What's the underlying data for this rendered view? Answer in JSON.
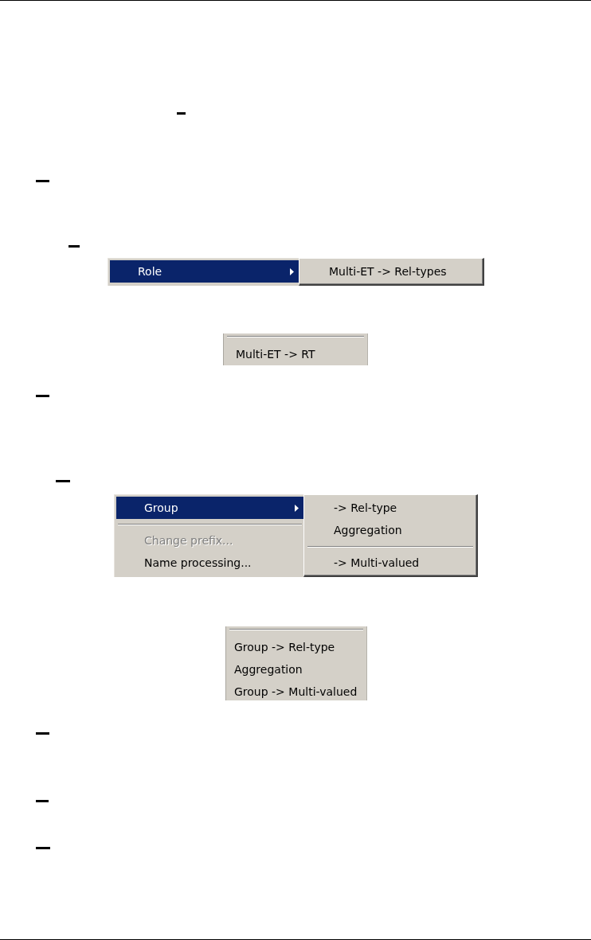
{
  "document": {
    "blocks": [
      {
        "kind": "dash"
      },
      {
        "kind": "dash"
      },
      {
        "kind": "dash"
      },
      {
        "kind": "cascade_menu",
        "items": [
          {
            "kind": "item",
            "label": "Role",
            "selected": true,
            "disabled": false,
            "submenu": [
              {
                "kind": "item",
                "label": "Multi-ET -> Rel-types",
                "selected": false,
                "disabled": false
              }
            ]
          }
        ]
      },
      {
        "kind": "menu_fragment",
        "items": [
          {
            "kind": "separator"
          },
          {
            "kind": "item",
            "label": "Multi-ET -> RT",
            "selected": false,
            "disabled": false
          }
        ]
      },
      {
        "kind": "dash"
      },
      {
        "kind": "dash"
      },
      {
        "kind": "cascade_menu",
        "items": [
          {
            "kind": "item",
            "label": "Group",
            "selected": true,
            "disabled": false,
            "submenu": [
              {
                "kind": "item",
                "label": "-> Rel-type",
                "selected": false,
                "disabled": false
              },
              {
                "kind": "item",
                "label": "Aggregation",
                "selected": false,
                "disabled": false
              },
              {
                "kind": "separator"
              },
              {
                "kind": "item",
                "label": "-> Multi-valued",
                "selected": false,
                "disabled": false
              }
            ]
          },
          {
            "kind": "separator"
          },
          {
            "kind": "item",
            "label": "Change prefix...",
            "selected": false,
            "disabled": true
          },
          {
            "kind": "item",
            "label": "Name processing...",
            "selected": false,
            "disabled": false
          }
        ]
      },
      {
        "kind": "menu_fragment",
        "items": [
          {
            "kind": "separator"
          },
          {
            "kind": "item",
            "label": "Group -> Rel-type",
            "selected": false,
            "disabled": false
          },
          {
            "kind": "item",
            "label": "Aggregation",
            "selected": false,
            "disabled": false
          },
          {
            "kind": "item",
            "label": "Group -> Multi-valued",
            "selected": false,
            "disabled": false
          }
        ]
      },
      {
        "kind": "dash"
      },
      {
        "kind": "dash"
      },
      {
        "kind": "dash"
      }
    ]
  }
}
